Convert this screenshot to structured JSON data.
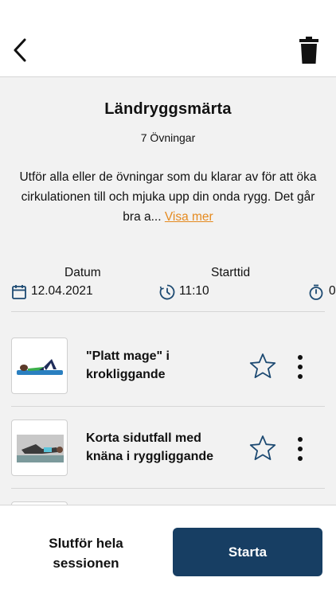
{
  "header": {
    "back_icon": "chevron-left-icon",
    "delete_icon": "trash-icon"
  },
  "session": {
    "title": "Ländryggsmärta",
    "subtitle": "7 Övningar",
    "description": "Utför alla eller de övningar som du klarar av för att öka cirkulationen till och mjuka upp din onda rygg. Det går bra a...",
    "show_more": "Visa mer",
    "accent_color": "#e58a1f"
  },
  "meta": {
    "date_label": "Datum",
    "date_value": "12.04.2021",
    "start_label": "Starttid",
    "start_value": "11:10",
    "duration_value": "0"
  },
  "exercises": [
    {
      "title": "\"Platt mage\" i krokliggande",
      "favorite_icon": "star-outline-icon",
      "menu_icon": "more-vertical-icon"
    },
    {
      "title": "Korta sidutfall med knäna i ryggliggande",
      "favorite_icon": "star-outline-icon",
      "menu_icon": "more-vertical-icon"
    }
  ],
  "footer": {
    "finish_label": "Slutför hela sessionen",
    "start_label": "Starta",
    "start_color": "#173e63"
  }
}
